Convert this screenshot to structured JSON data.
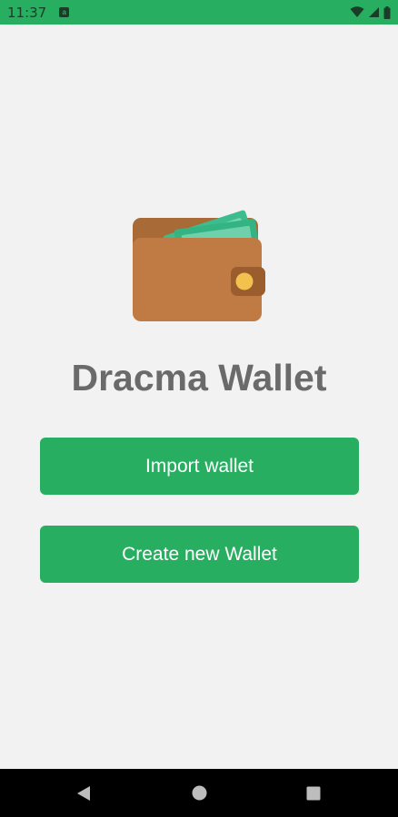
{
  "status_bar": {
    "time": "11:37",
    "notification_icon": "a",
    "icons": [
      "wifi-icon",
      "signal-icon",
      "battery-icon"
    ]
  },
  "app": {
    "title": "Dracma Wallet",
    "logo_icon": "wallet-icon"
  },
  "actions": {
    "import_label": "Import wallet",
    "create_label": "Create new Wallet"
  },
  "nav_bar": {
    "icons": [
      "back-icon",
      "home-icon",
      "recents-icon"
    ]
  },
  "colors": {
    "accent": "#27ae60",
    "background": "#f2f2f2",
    "title": "#6a6a6a",
    "wallet": "#c07a44"
  }
}
